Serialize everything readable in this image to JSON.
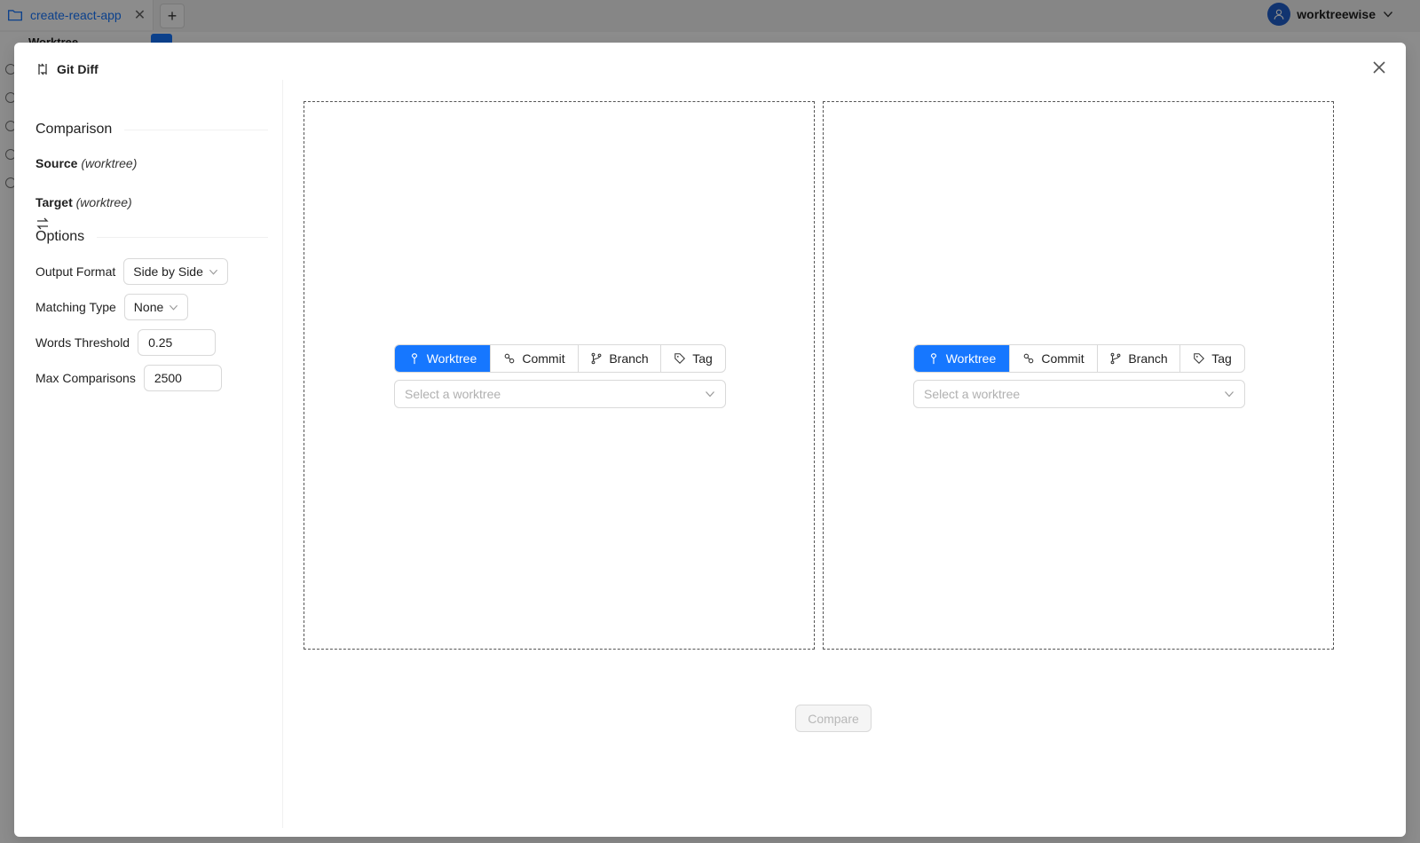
{
  "app": {
    "tab_label": "create-react-app",
    "user_name": "worktreewise",
    "workspace_label": "Worktree"
  },
  "modal": {
    "title": "Git Diff",
    "comparison": {
      "heading": "Comparison",
      "source_label": "Source",
      "source_type": "(worktree)",
      "target_label": "Target",
      "target_type": "(worktree)"
    },
    "options": {
      "heading": "Options",
      "output_format_label": "Output Format",
      "output_format_value": "Side by Side",
      "matching_type_label": "Matching Type",
      "matching_type_value": "None",
      "words_threshold_label": "Words Threshold",
      "words_threshold_value": "0.25",
      "max_comparisons_label": "Max Comparisons",
      "max_comparisons_value": "2500"
    },
    "source_pane": {
      "ref_types": [
        "Worktree",
        "Commit",
        "Branch",
        "Tag"
      ],
      "selected_type": "Worktree",
      "select_placeholder": "Select a worktree"
    },
    "target_pane": {
      "ref_types": [
        "Worktree",
        "Commit",
        "Branch",
        "Tag"
      ],
      "selected_type": "Worktree",
      "select_placeholder": "Select a worktree"
    },
    "compare_button": "Compare",
    "compare_enabled": false
  },
  "colors": {
    "accent": "#1677ff",
    "border": "#d9d9d9",
    "placeholder": "#b0b0b0",
    "disabled_text": "#b8b8b8"
  },
  "icons": {
    "tab": "folder-icon",
    "close": "close-icon",
    "title": "diff-icon",
    "swap": "swap-icon",
    "worktree": "worktree-icon",
    "commit": "commit-icon",
    "branch": "branch-icon",
    "tag": "tag-icon"
  }
}
